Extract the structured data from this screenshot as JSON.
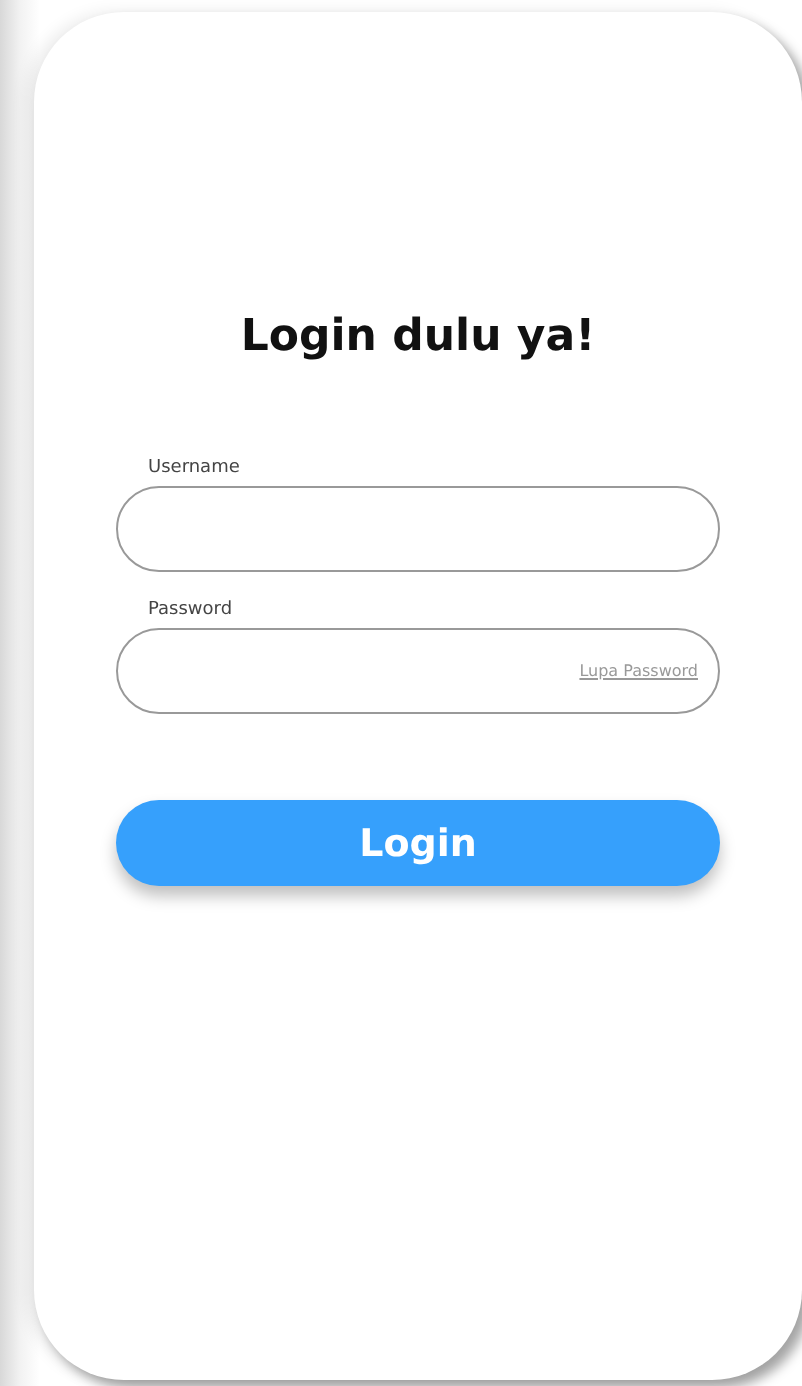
{
  "title": "Login dulu ya!",
  "fields": [
    {
      "label": "Username"
    },
    {
      "label": "Password",
      "link": "Lupa Password"
    }
  ],
  "button": "Login"
}
